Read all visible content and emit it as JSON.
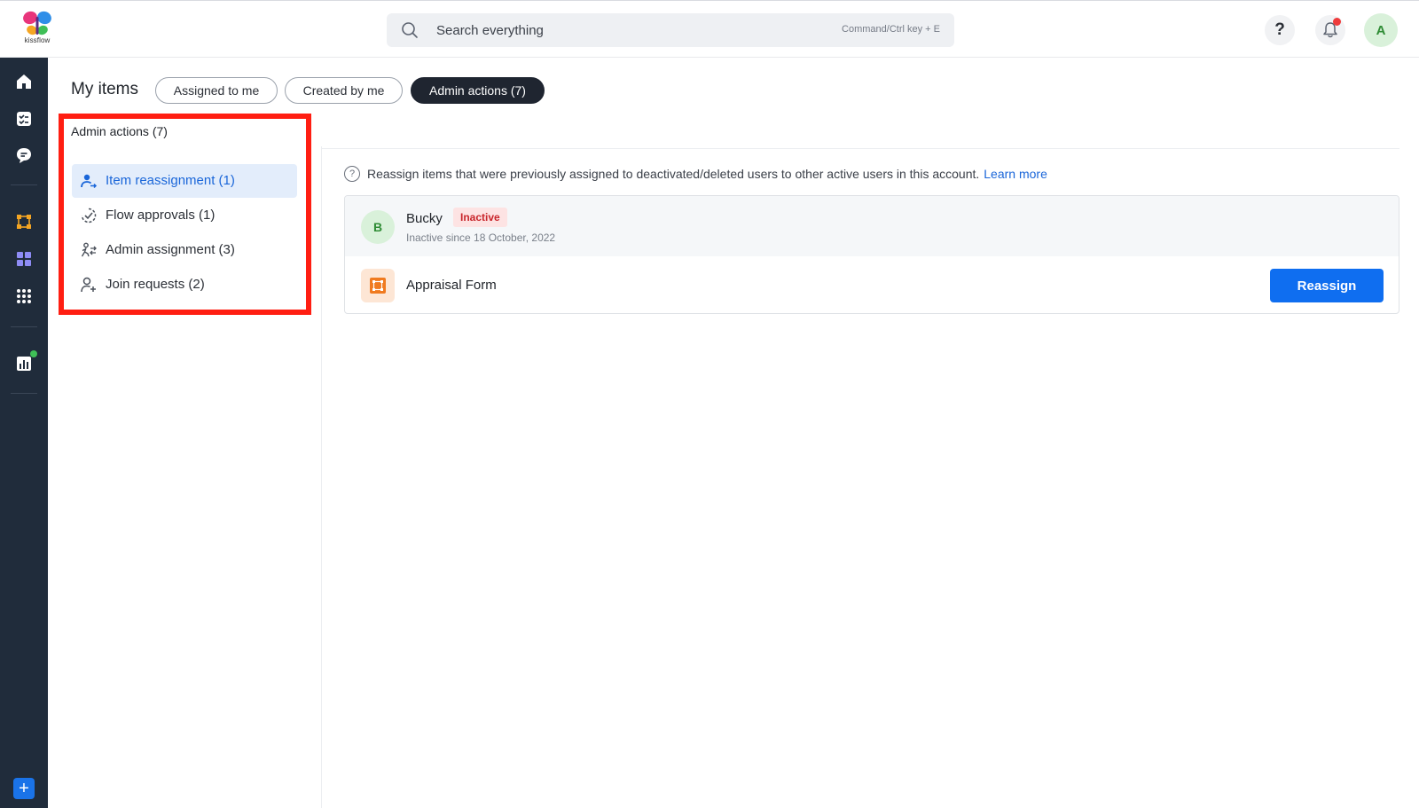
{
  "brand": {
    "logo_text": "kissflow"
  },
  "search": {
    "placeholder": "Search everything",
    "shortcut": "Command/Ctrl key + E"
  },
  "header": {
    "help_label": "?",
    "user_initial": "A"
  },
  "rail": {
    "icons": [
      "home-icon",
      "tasks-icon",
      "chat-icon",
      "flows-icon",
      "apps-icon",
      "app-grid-icon",
      "analytics-icon"
    ],
    "add_label": "+"
  },
  "page": {
    "title": "My items",
    "tabs": [
      {
        "label": "Assigned to me",
        "active": false
      },
      {
        "label": "Created by me",
        "active": false
      },
      {
        "label": "Admin actions (7)",
        "active": true
      }
    ]
  },
  "sidebar": {
    "title": "Admin actions (7)",
    "items": [
      {
        "label": "Item reassignment (1)",
        "icon": "user-reassign-icon",
        "active": true
      },
      {
        "label": "Flow approvals (1)",
        "icon": "approval-check-icon",
        "active": false
      },
      {
        "label": "Admin assignment (3)",
        "icon": "admin-transfer-icon",
        "active": false
      },
      {
        "label": "Join requests (2)",
        "icon": "user-add-icon",
        "active": false
      }
    ]
  },
  "main": {
    "info_text": "Reassign items that were previously assigned to deactivated/deleted users to other active users in this account.",
    "learn_more": "Learn more",
    "card": {
      "user_initial": "B",
      "user_name": "Bucky",
      "status_badge": "Inactive",
      "inactive_since": "Inactive since 18 October, 2022",
      "form_name": "Appraisal Form",
      "reassign_label": "Reassign"
    }
  },
  "colors": {
    "rail_bg": "#202c3b",
    "accent": "#0f6ef0",
    "highlight_box": "#ff1e12",
    "active_tab": "#1f2530",
    "inactive_badge_bg": "#fde3e3",
    "inactive_badge_text": "#c9262c"
  }
}
